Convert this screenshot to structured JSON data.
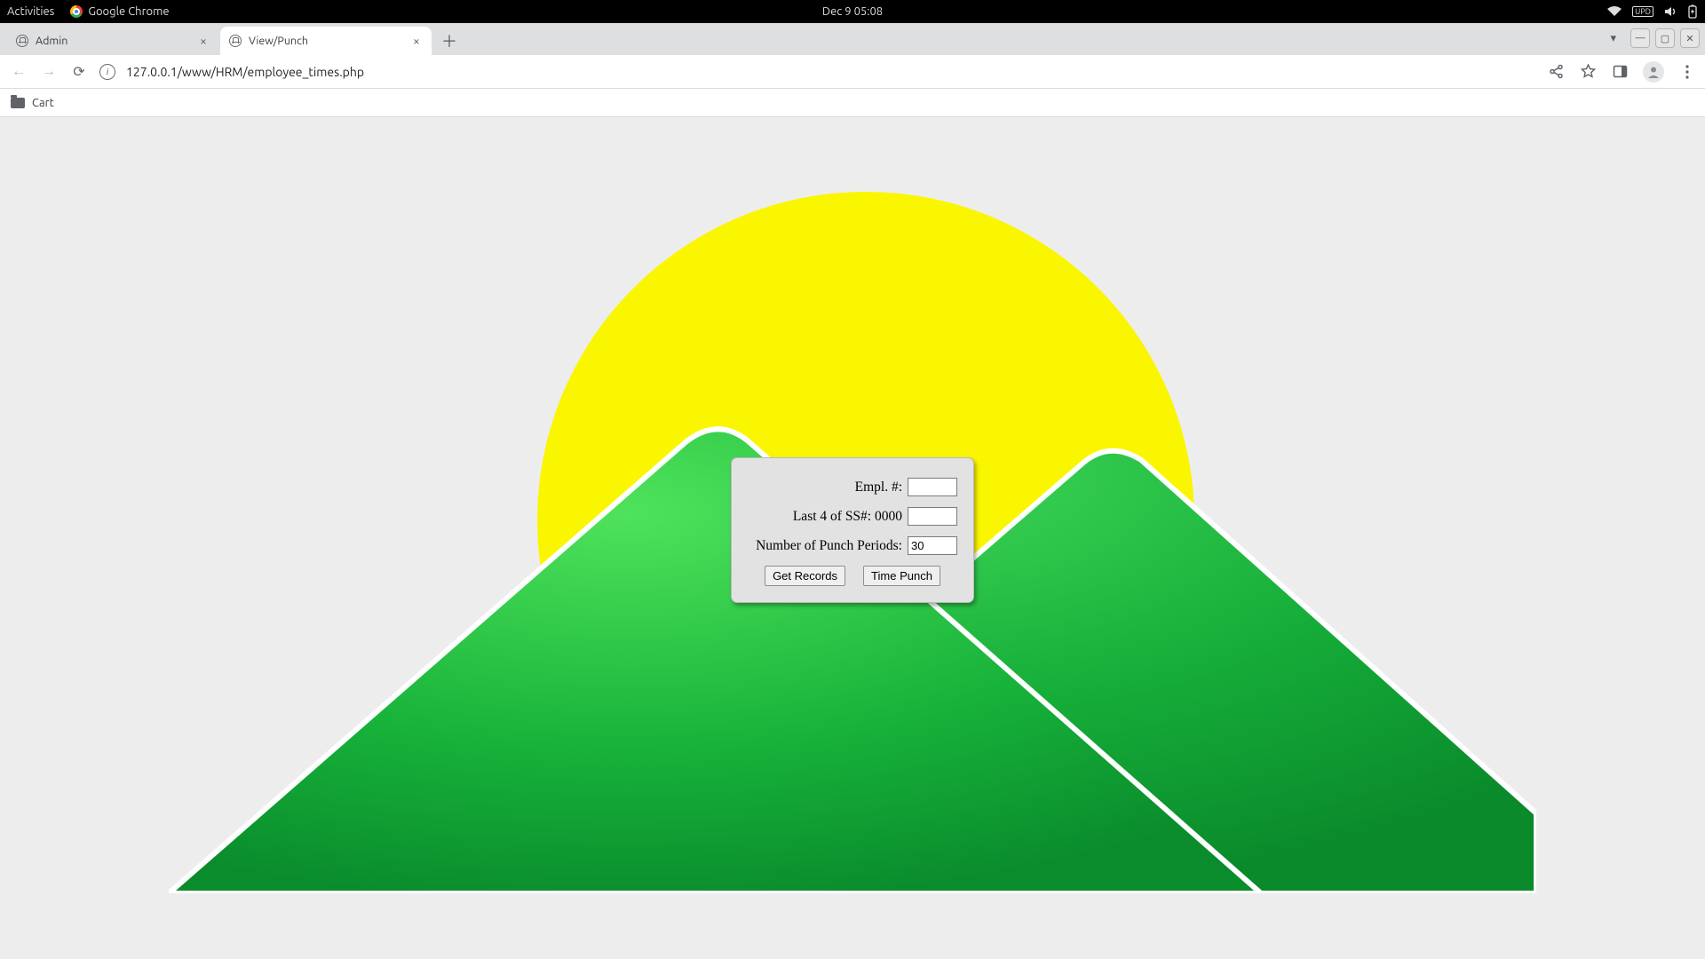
{
  "menubar": {
    "activities": "Activities",
    "app_name": "Google Chrome",
    "datetime": "Dec 9  05:08"
  },
  "tabs": [
    {
      "title": "Admin",
      "active": false
    },
    {
      "title": "View/Punch",
      "active": true
    }
  ],
  "omnibox": {
    "url": "127.0.0.1/www/HRM/employee_times.php"
  },
  "bookmarks": [
    {
      "label": "Cart"
    }
  ],
  "form": {
    "empl_label": "Empl. #:",
    "empl_value": "",
    "ss_label": "Last 4 of SS#: 0000",
    "ss_value": "",
    "periods_label": "Number of Punch Periods:",
    "periods_value": "30",
    "get_records_label": "Get Records",
    "time_punch_label": "Time Punch"
  }
}
